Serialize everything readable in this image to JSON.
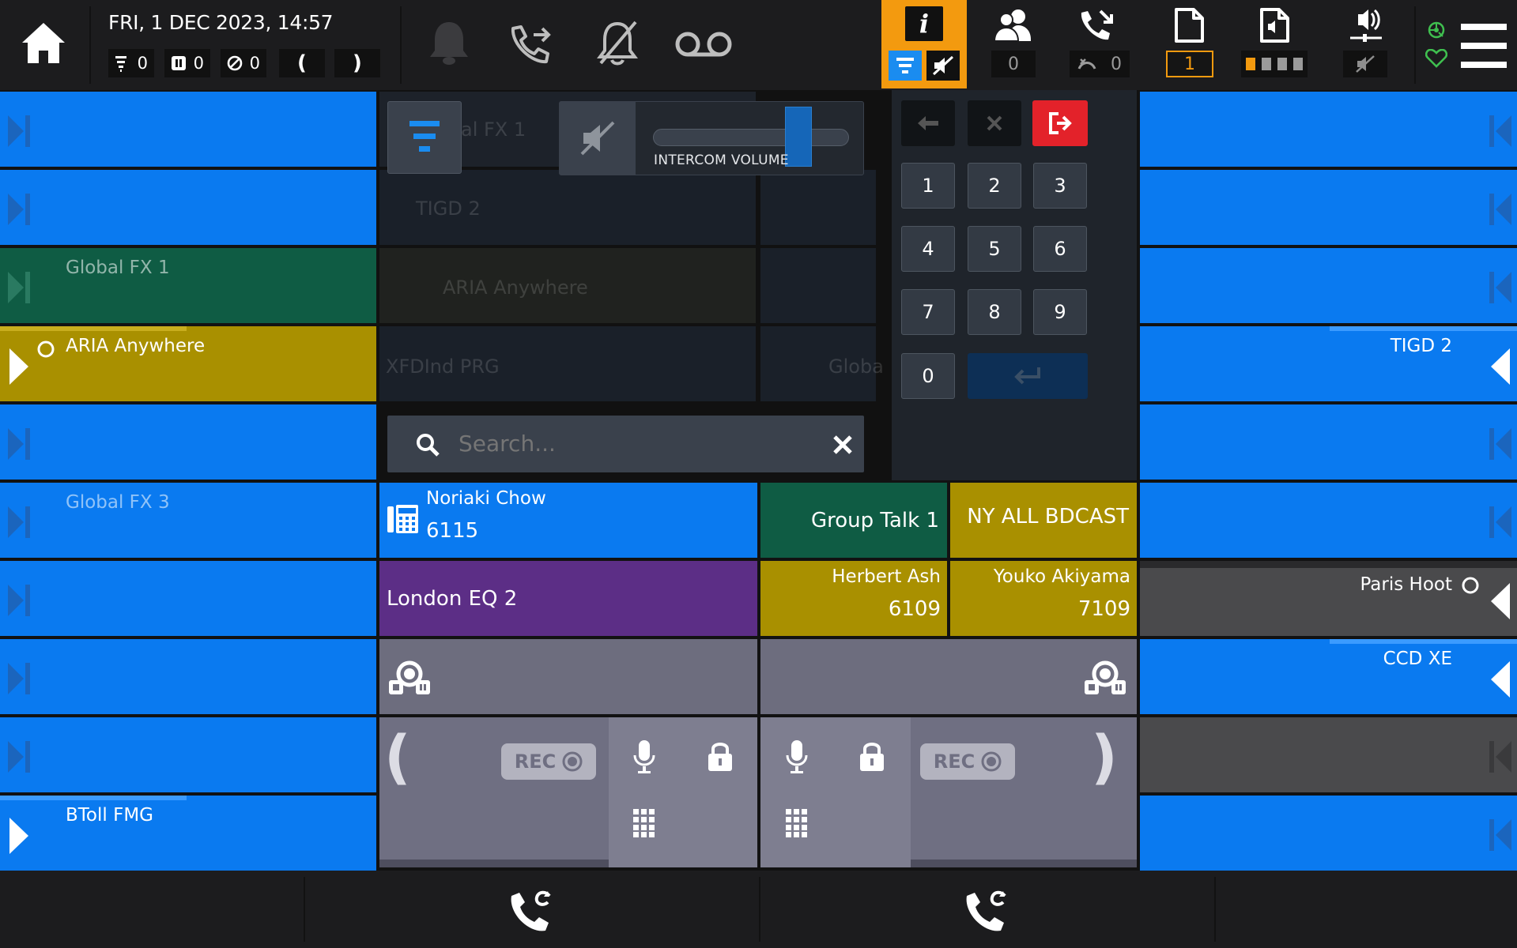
{
  "header": {
    "datetime": "FRI, 1 DEC 2023, 14:57",
    "counters": {
      "queued": "0",
      "held": "0",
      "blocked": "0"
    },
    "paren_left": "(",
    "paren_right": ")",
    "users_count": "0",
    "calls_count": "0",
    "page_badge": "1",
    "info_label": "i"
  },
  "left_column": [
    {
      "label": "",
      "color": "blue",
      "icon": "skip-next-icon"
    },
    {
      "label": "",
      "color": "blue",
      "icon": "skip-next-icon"
    },
    {
      "label": "Global FX 1",
      "color": "green",
      "icon": "skip-next-icon"
    },
    {
      "label": "ARIA Anywhere",
      "color": "gold",
      "icon": "play-right-icon"
    },
    {
      "label": "",
      "color": "blue",
      "icon": "skip-next-icon"
    },
    {
      "label": "Global FX 3",
      "color": "blue",
      "icon": "skip-next-icon"
    },
    {
      "label": "",
      "color": "blue",
      "icon": "skip-next-icon"
    },
    {
      "label": "",
      "color": "blue",
      "icon": "skip-next-icon"
    },
    {
      "label": "",
      "color": "blue",
      "icon": "skip-next-icon"
    },
    {
      "label": "BToll FMG",
      "color": "blue",
      "icon": "play-right-icon"
    }
  ],
  "right_column": [
    {
      "label": "",
      "color": "blue"
    },
    {
      "label": "",
      "color": "blue"
    },
    {
      "label": "",
      "color": "blue"
    },
    {
      "label": "TIGD 2",
      "color": "blue"
    },
    {
      "label": "",
      "color": "blue"
    },
    {
      "label": "",
      "color": "blue"
    },
    {
      "label": "Paris Hoot",
      "color": "grey"
    },
    {
      "label": "CCD XE",
      "color": "blue"
    },
    {
      "label": "",
      "color": "grey"
    },
    {
      "label": "",
      "color": "blue"
    }
  ],
  "middle": {
    "noriaki": {
      "name": "Noriaki Chow",
      "ext": "6115"
    },
    "group_talk": "Group Talk 1",
    "ny_bdcast": "NY ALL BDCAST",
    "london": "London EQ 2",
    "herbert": {
      "name": "Herbert Ash",
      "ext": "6109"
    },
    "youko": {
      "name": "Youko Akiyama",
      "ext": "7109"
    }
  },
  "handset": {
    "rec_label": "REC",
    "left_paren": "(",
    "right_paren": ")"
  },
  "overlay": {
    "intercom_label": "INTERCOM VOLUME",
    "intercom_level": 0.78,
    "search_placeholder": "Search...",
    "keys": [
      "1",
      "2",
      "3",
      "4",
      "5",
      "6",
      "7",
      "8",
      "9",
      "0"
    ],
    "ghost_rows": [
      "al FX 1",
      "TIGD 2",
      "ARIA Anywhere",
      "XFDInd PRG",
      "Globa"
    ]
  },
  "colors": {
    "blue": "#0a7af0",
    "green": "#0f5c44",
    "gold": "#a99000",
    "purple": "#5c2e86",
    "grey": "#4a4a4c",
    "accent_orange": "#f39a0f",
    "exit_red": "#e3222a"
  }
}
